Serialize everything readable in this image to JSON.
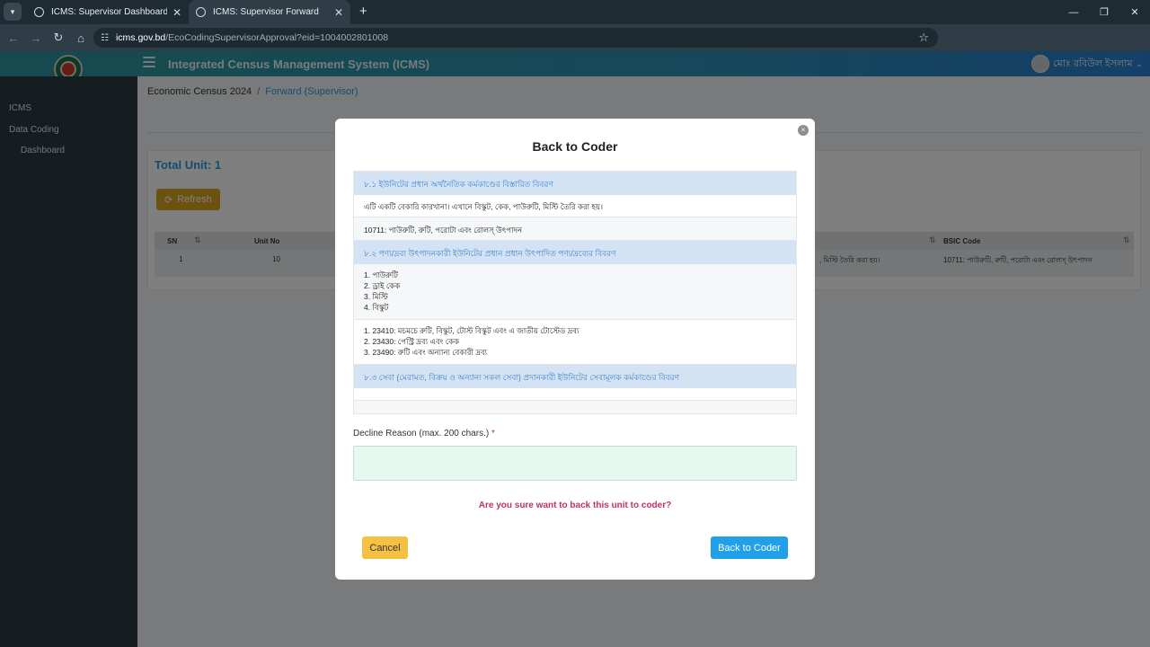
{
  "browser": {
    "tabs": [
      {
        "title": "ICMS: Supervisor Dashboard",
        "active": false
      },
      {
        "title": "ICMS: Supervisor Forward",
        "active": true
      }
    ],
    "url_host": "icms.gov.bd",
    "url_path": "/EcoCodingSupervisorApproval?eid=1004002801008"
  },
  "app": {
    "title": "Integrated Census Management System (ICMS)",
    "user_name": "মোঃ রবিউল ইসলাম"
  },
  "sidebar": {
    "items": [
      "ICMS",
      "Data Coding",
      "Dashboard"
    ]
  },
  "breadcrumb": {
    "root": "Economic Census 2024",
    "separator": "/",
    "current": "Forward (Supervisor)"
  },
  "main": {
    "total_unit": "Total Unit: 1",
    "refresh_label": "Refresh",
    "table": {
      "headers": [
        "SN",
        "Unit No",
        "BSIC Code"
      ],
      "row": {
        "sn": "1",
        "unit_no": "10",
        "description_tail": ", মিস্টি তৈরি করা হয়।",
        "bsic": "10711: পাউরুটি, রুটি, পরোটা এবং রোলস্ উৎপাদন"
      }
    }
  },
  "modal": {
    "title": "Back to Coder",
    "close_icon": "×",
    "sections": [
      {
        "heading": "৮.১ ইউনিটের প্রধান অর্থনৈতিক কর্মকাণ্ডের বিস্তারিত বিবরণ",
        "rows": [
          [
            "এটি একটি বেকারি কারখানা। এখানে বিস্কুট, কেক, পাউরুটি, মিস্টি তৈরি করা হয়।"
          ],
          [
            "10711: পাউরুটি, রুটি, পরোটা এবং রোলস্ উৎপাদন"
          ]
        ]
      },
      {
        "heading": "৮.২ পণ্য/দ্রব্য উৎপাদনকারী ইউনিটের প্রধান প্রধান উৎপাদিত পণ্য/দ্রব্যের বিবরণ",
        "rows": [
          [
            "1. পাউরুটি",
            "2. ড্রাই কেক",
            "3. মিস্টি",
            "4. বিস্কুট"
          ],
          [
            "1. 23410: মচমচে রুটি, বিস্কুট, টোস্ট বিস্কুট এবং এ জাতীয় টোস্টেড দ্রব্য",
            "2. 23430: পেস্ট্রি দ্রব্য এবং কেক",
            "3. 23490: রুটি এবং অন্যান্য বেকারী দ্রব্য"
          ]
        ]
      },
      {
        "heading": "৮.৩ সেবা (মেরামত, বিক্রয় ও অন্যান্য সকল সেবা) প্রদানকারী ইউনিটের সেবামূলক কর্মকাণ্ডের বিবরণ",
        "rows": []
      }
    ],
    "decline_label": "Decline Reason (max. 200 chars.)",
    "required_mark": "*",
    "decline_value": "",
    "confirm_question": "Are you sure want to back this unit to coder?",
    "cancel_label": "Cancel",
    "back_label": "Back to Coder"
  }
}
